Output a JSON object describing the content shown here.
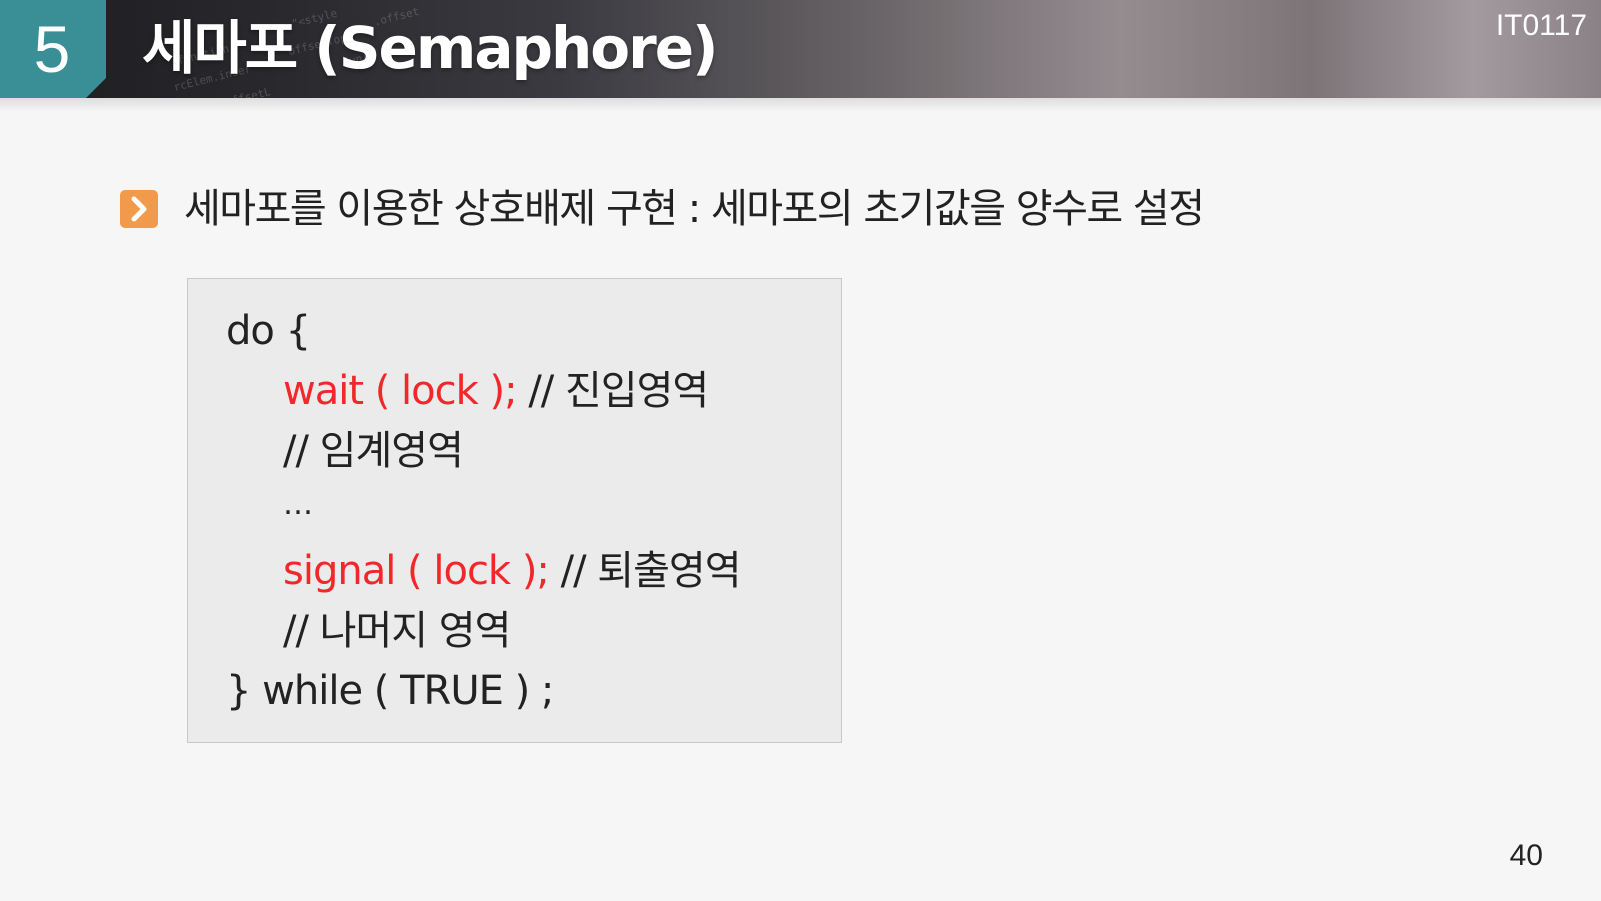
{
  "colors": {
    "accent_teal": "#3a8f96",
    "bullet_orange": "#f19a4c",
    "code_highlight_red": "#f0282a",
    "code_box_background": "#ebebeb"
  },
  "header": {
    "section_number": "5",
    "title": "세마포 (Semaphore)",
    "course_code": "IT0117"
  },
  "bullet": {
    "icon": "chevron-right-icon",
    "text": "세마포를 이용한 상호배제 구현 : 세마포의 초기값을 양수로 설정"
  },
  "code": {
    "line1": "do {",
    "line2_code": "wait ( lock );",
    "line2_comment": " // 진입영역",
    "line3": "// 임계영역",
    "line4": "…",
    "line5_code": "signal ( lock );",
    "line5_comment": " // 퇴출영역",
    "line6": "// 나머지 영역",
    "line7": "} while ( TRUE ) ;"
  },
  "page_number": "40"
}
